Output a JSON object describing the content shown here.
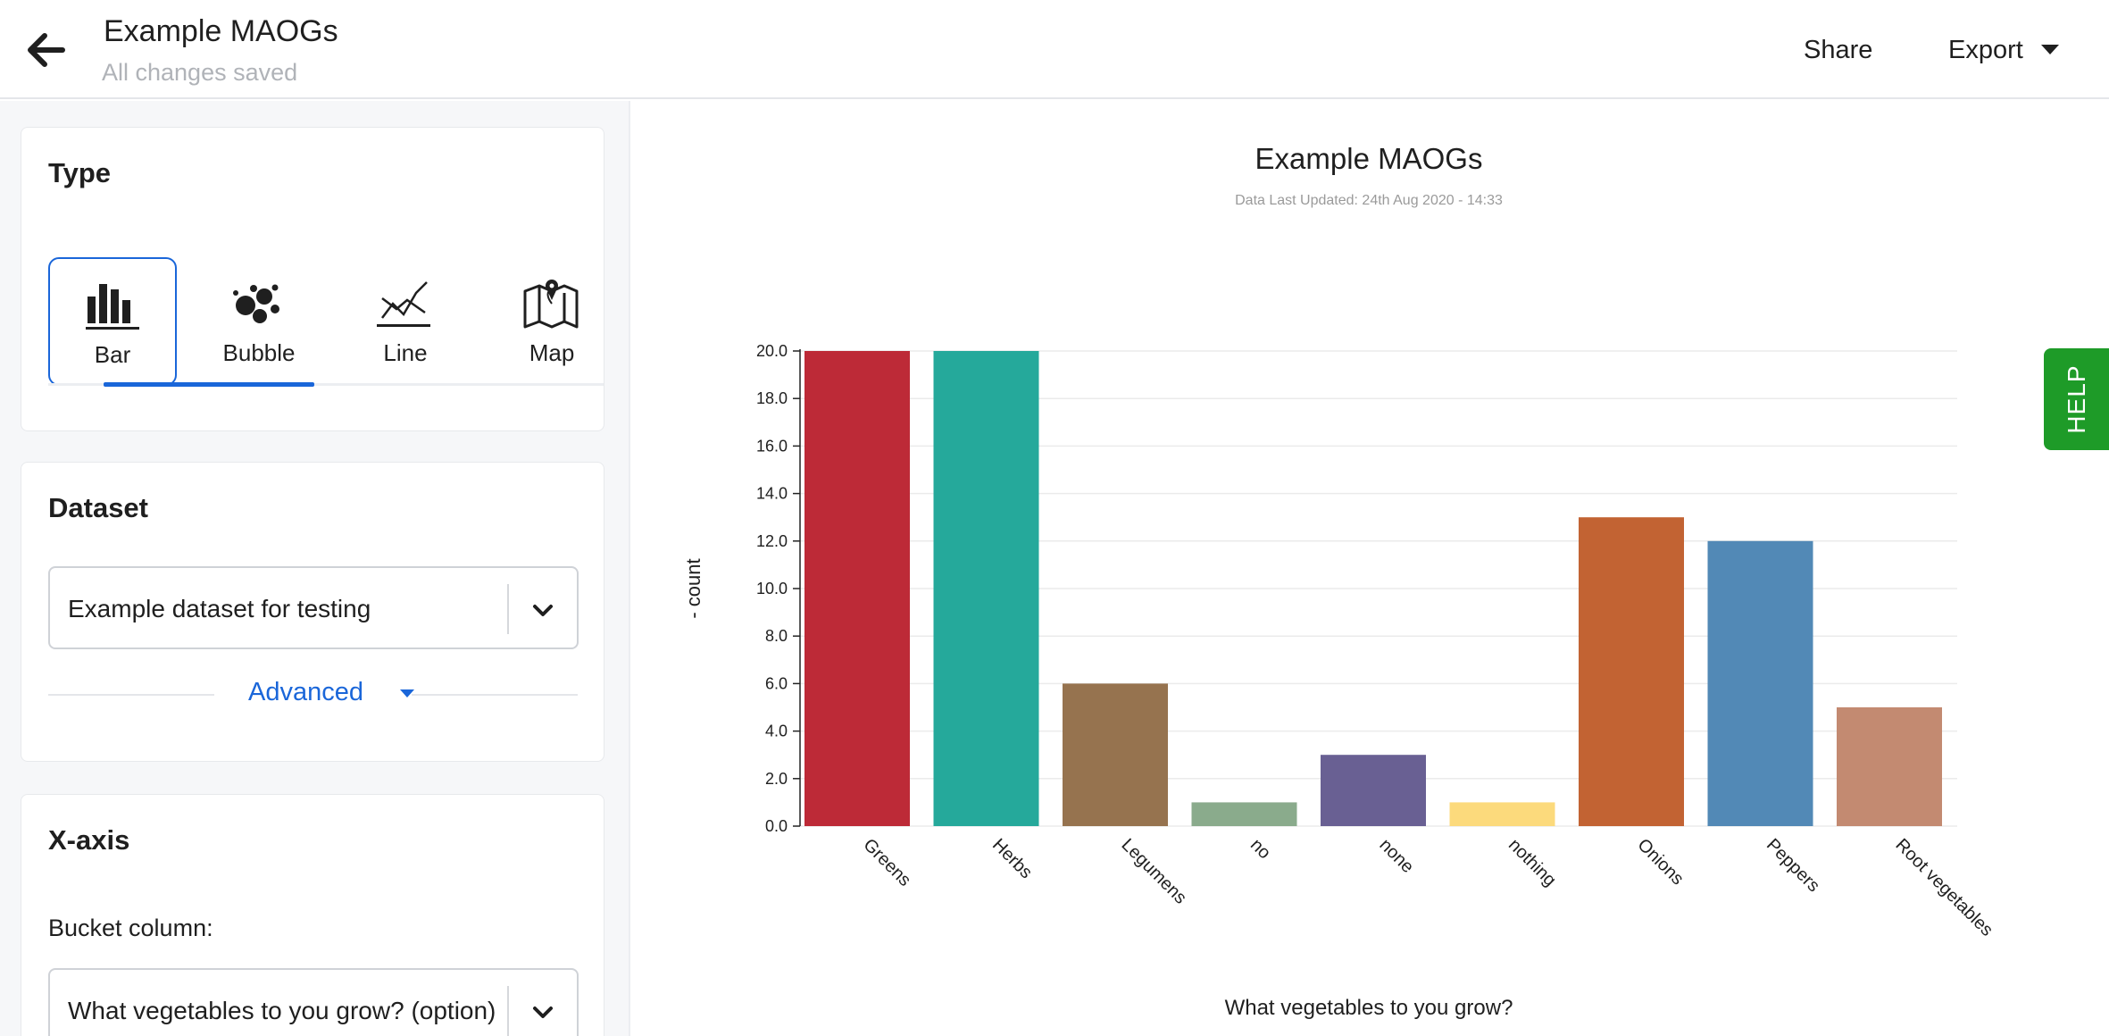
{
  "header": {
    "title": "Example MAOGs",
    "save_status": "All changes saved",
    "share_label": "Share",
    "export_label": "Export"
  },
  "sidebar": {
    "type_card": {
      "title": "Type",
      "options": [
        {
          "label": "Bar",
          "icon": "bar-chart-icon",
          "selected": true
        },
        {
          "label": "Bubble",
          "icon": "bubble-chart-icon",
          "selected": false
        },
        {
          "label": "Line",
          "icon": "line-chart-icon",
          "selected": false
        },
        {
          "label": "Map",
          "icon": "map-icon",
          "selected": false
        }
      ]
    },
    "dataset_card": {
      "title": "Dataset",
      "selected_dataset": "Example dataset for testing",
      "advanced_label": "Advanced"
    },
    "xaxis_card": {
      "title": "X-axis",
      "bucket_label": "Bucket column:",
      "bucket_value": "What vegetables to you grow? (option)"
    }
  },
  "help_label": "HELP",
  "chart_data": {
    "type": "bar",
    "title": "Example MAOGs",
    "subtitle": "Data Last Updated: 24th Aug 2020 - 14:33",
    "xlabel": "What vegetables to you grow?",
    "ylabel": "- count",
    "categories": [
      "Greens",
      "Herbs",
      "Legumens",
      "no",
      "none",
      "nothing",
      "Onions",
      "Peppers",
      "Root vegetables"
    ],
    "values": [
      20,
      20,
      6,
      1,
      3,
      1,
      13,
      12,
      5
    ],
    "colors": [
      "#bd2a37",
      "#25a99b",
      "#96734f",
      "#8aab8c",
      "#696093",
      "#fcda7c",
      "#c26333",
      "#5289b6",
      "#c38a71"
    ],
    "ylim": [
      0,
      20
    ],
    "yticks": [
      "0.0",
      "2.0",
      "4.0",
      "6.0",
      "8.0",
      "10.0",
      "12.0",
      "14.0",
      "16.0",
      "18.0",
      "20.0"
    ],
    "grid": true,
    "legend": "none"
  }
}
